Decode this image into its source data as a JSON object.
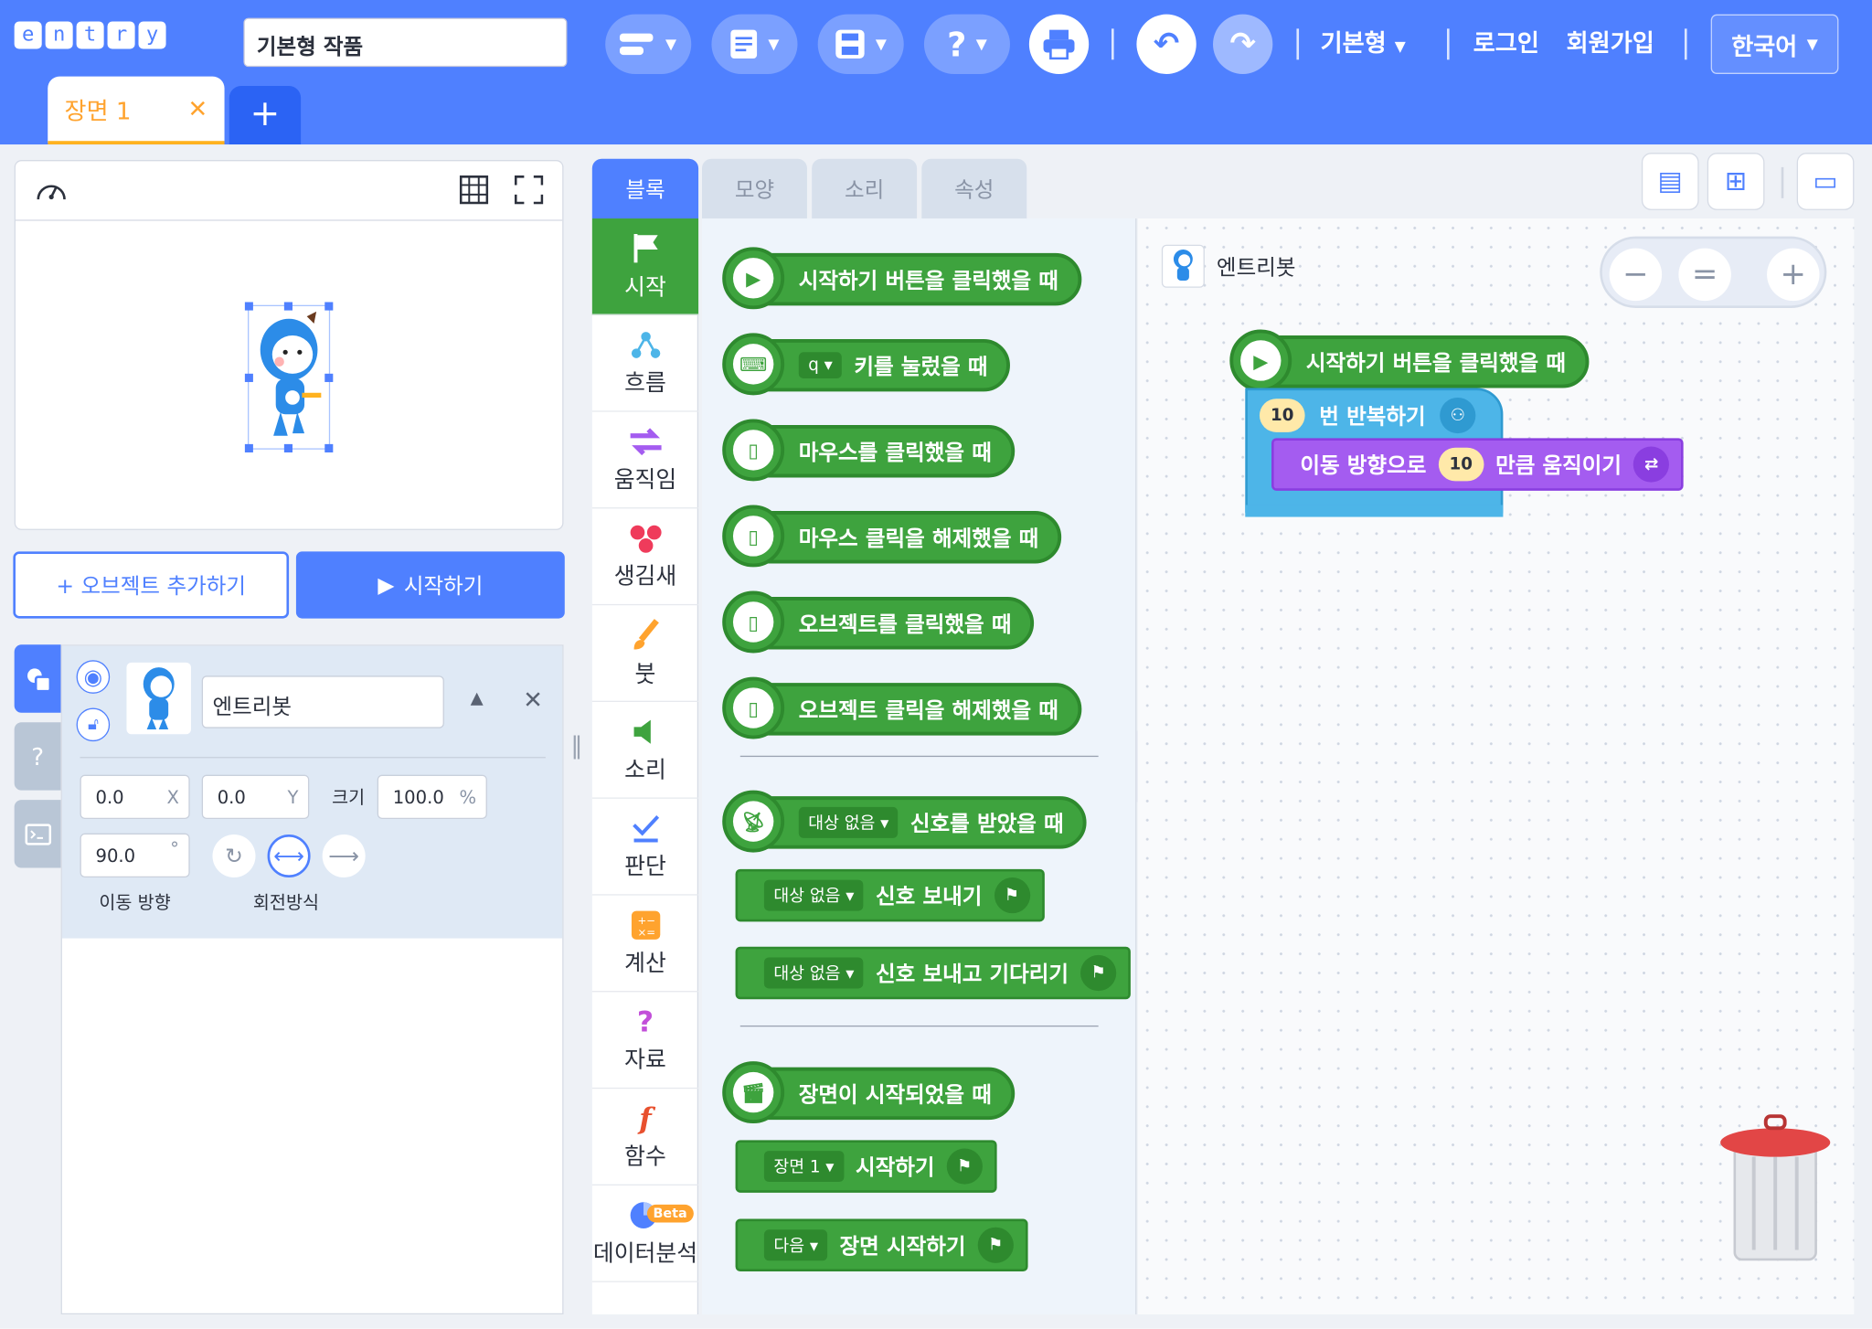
{
  "header": {
    "logo_letters": [
      "e",
      "n",
      "t",
      "r",
      "y"
    ],
    "project_title": "기본형 작품",
    "mode_label": "기본형",
    "login_label": "로그인",
    "signup_label": "회원가입",
    "language_label": "한국어"
  },
  "scenes": {
    "tab_label": "장면 1",
    "close_glyph": "✕",
    "add_glyph": "+"
  },
  "stage": {
    "add_object_label": "+ 오브젝트 추가하기",
    "start_label": "시작하기"
  },
  "object": {
    "name": "엔트리봇",
    "x_value": "0.0",
    "x_suffix": "X",
    "y_value": "0.0",
    "y_suffix": "Y",
    "size_label": "크기",
    "size_value": "100.0",
    "size_suffix": "%",
    "direction_value": "90.0",
    "direction_suffix": "°",
    "direction_label": "이동 방향",
    "rotation_label": "회전방식"
  },
  "palette_tabs": [
    "블록",
    "모양",
    "소리",
    "속성"
  ],
  "categories": [
    {
      "label": "시작",
      "icon": "flag-icon"
    },
    {
      "label": "흐름",
      "icon": "flow-icon"
    },
    {
      "label": "움직임",
      "icon": "move-icon"
    },
    {
      "label": "생김새",
      "icon": "looks-icon"
    },
    {
      "label": "붓",
      "icon": "brush-icon"
    },
    {
      "label": "소리",
      "icon": "speaker-icon"
    },
    {
      "label": "판단",
      "icon": "check-icon"
    },
    {
      "label": "계산",
      "icon": "calc-icon"
    },
    {
      "label": "자료",
      "icon": "question-icon"
    },
    {
      "label": "함수",
      "icon": "function-icon"
    },
    {
      "label": "데이터분석",
      "icon": "pie-icon"
    }
  ],
  "beta_badge": "Beta",
  "palette_blocks": {
    "b1": "시작하기 버튼을 클릭했을 때",
    "b2_key": "q",
    "b2": "키를 눌렀을 때",
    "b3": "마우스를 클릭했을 때",
    "b4": "마우스 클릭을 해제했을 때",
    "b5": "오브젝트를 클릭했을 때",
    "b6": "오브젝트 클릭을 해제했을 때",
    "b7_dd": "대상 없음",
    "b7": "신호를 받았을 때",
    "b8_dd": "대상 없음",
    "b8": "신호 보내기",
    "b9_dd": "대상 없음",
    "b9": "신호 보내고 기다리기",
    "b10": "장면이 시작되었을 때",
    "b11_dd": "장면 1",
    "b11": "시작하기",
    "b12_dd": "다음",
    "b12": "장면 시작하기"
  },
  "workspace": {
    "object_label": "엔트리봇",
    "hat_label": "시작하기 버튼을 클릭했을 때",
    "repeat_count": "10",
    "repeat_label": "번 반복하기",
    "move_prefix": "이동 방향으로",
    "move_amount": "10",
    "move_suffix": "만큼 움직이기"
  },
  "colors": {
    "header_blue": "#4f80ff",
    "start_green": "#3ea33e",
    "flow_blue": "#4db5e8",
    "move_purple": "#a45cf0",
    "scene_orange": "#ffa32e"
  }
}
